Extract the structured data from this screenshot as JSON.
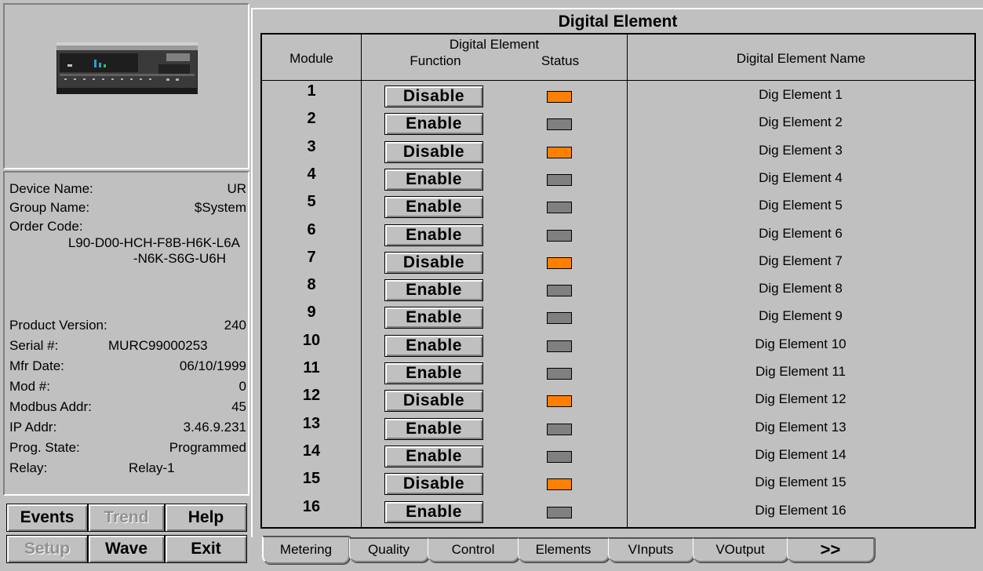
{
  "device": {
    "info": {
      "device_name_label": "Device Name:",
      "device_name": "UR",
      "group_name_label": "Group Name:",
      "group_name": "$System",
      "order_code_label": "Order Code:",
      "order_code_line1": "L90-D00-HCH-F8B-H6K-L6A",
      "order_code_line2": "-N6K-S6G-U6H",
      "product_version_label": "Product Version:",
      "product_version": "240",
      "serial_label": "Serial #:",
      "serial": "MURC99000253",
      "mfr_date_label": "Mfr Date:",
      "mfr_date": "06/10/1999",
      "mod_label": "Mod #:",
      "mod": "0",
      "modbus_label": "Modbus Addr:",
      "modbus": "45",
      "ip_label": "IP Addr:",
      "ip": "3.46.9.231",
      "prog_state_label": "Prog. State:",
      "prog_state": "Programmed",
      "relay_label": "Relay:",
      "relay": "Relay-1"
    }
  },
  "nav_buttons": {
    "events": "Events",
    "trend": "Trend",
    "help": "Help",
    "setup": "Setup",
    "wave": "Wave",
    "exit": "Exit"
  },
  "main": {
    "title": "Digital Element",
    "headers": {
      "module": "Module",
      "group": "Digital Element",
      "function": "Function",
      "status": "Status",
      "name": "Digital Element Name"
    },
    "status_colors": {
      "active": "#ff8000",
      "inactive": "#808080"
    },
    "rows": [
      {
        "module": "1",
        "function": "Disable",
        "status": "active",
        "name": "Dig Element 1"
      },
      {
        "module": "2",
        "function": "Enable",
        "status": "inactive",
        "name": "Dig Element 2"
      },
      {
        "module": "3",
        "function": "Disable",
        "status": "active",
        "name": "Dig Element 3"
      },
      {
        "module": "4",
        "function": "Enable",
        "status": "inactive",
        "name": "Dig Element 4"
      },
      {
        "module": "5",
        "function": "Enable",
        "status": "inactive",
        "name": "Dig Element 5"
      },
      {
        "module": "6",
        "function": "Enable",
        "status": "inactive",
        "name": "Dig Element 6"
      },
      {
        "module": "7",
        "function": "Disable",
        "status": "active",
        "name": "Dig Element 7"
      },
      {
        "module": "8",
        "function": "Enable",
        "status": "inactive",
        "name": "Dig Element 8"
      },
      {
        "module": "9",
        "function": "Enable",
        "status": "inactive",
        "name": "Dig Element 9"
      },
      {
        "module": "10",
        "function": "Enable",
        "status": "inactive",
        "name": "Dig Element 10"
      },
      {
        "module": "11",
        "function": "Enable",
        "status": "inactive",
        "name": "Dig Element 11"
      },
      {
        "module": "12",
        "function": "Disable",
        "status": "active",
        "name": "Dig Element 12"
      },
      {
        "module": "13",
        "function": "Enable",
        "status": "inactive",
        "name": "Dig Element 13"
      },
      {
        "module": "14",
        "function": "Enable",
        "status": "inactive",
        "name": "Dig Element 14"
      },
      {
        "module": "15",
        "function": "Disable",
        "status": "active",
        "name": "Dig Element 15"
      },
      {
        "module": "16",
        "function": "Enable",
        "status": "inactive",
        "name": "Dig Element 16"
      }
    ]
  },
  "tabs": [
    "Metering",
    "Quality",
    "Control",
    "Elements",
    "VInputs",
    "VOutput",
    ">>"
  ],
  "active_tab": "Metering"
}
